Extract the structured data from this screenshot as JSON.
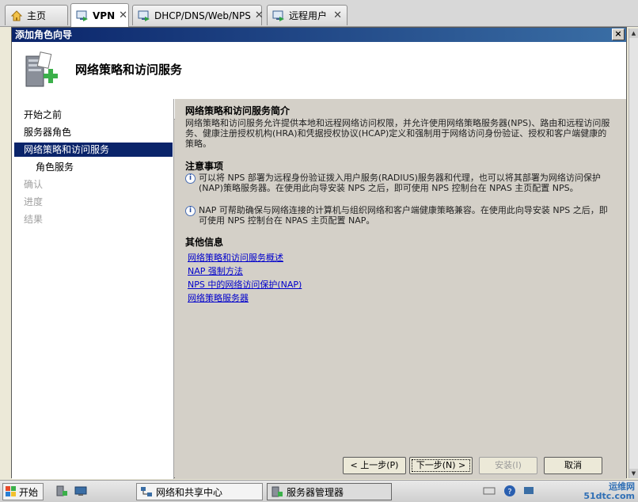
{
  "tabs": [
    {
      "label": "主页",
      "icon": "home-icon"
    },
    {
      "label": "VPN",
      "icon": "vpn-icon",
      "active": true
    },
    {
      "label": "DHCP/DNS/Web/NPS",
      "icon": "monitor-icon"
    },
    {
      "label": "远程用户",
      "icon": "monitor-icon"
    }
  ],
  "wizard": {
    "title": "添加角色向导",
    "close": "×",
    "header_title": "网络策略和访问服务",
    "nav": [
      {
        "label": "开始之前"
      },
      {
        "label": "服务器角色"
      },
      {
        "label": "网络策略和访问服务",
        "selected": true
      },
      {
        "label": "角色服务"
      },
      {
        "label": "确认"
      },
      {
        "label": "进度"
      },
      {
        "label": "结果"
      }
    ],
    "intro_title": "网络策略和访问服务简介",
    "intro_text": "网络策略和访问服务允许提供本地和远程网络访问权限，并允许使用网络策略服务器(NPS)、路由和远程访问服务、健康注册授权机构(HRA)和凭据授权协议(HCAP)定义和强制用于网络访问身份验证、授权和客户端健康的策略。",
    "notes_title": "注意事项",
    "notes": [
      "可以将 NPS 部署为远程身份验证拨入用户服务(RADIUS)服务器和代理，也可以将其部署为网络访问保护(NAP)策略服务器。在使用此向导安装 NPS 之后，即可使用 NPS 控制台在 NPAS 主页配置 NPS。",
      "NAP 可帮助确保与网络连接的计算机与组织网络和客户端健康策略兼容。在使用此向导安装 NPS 之后，即可使用 NPS 控制台在 NPAS 主页配置 NAP。"
    ],
    "info_title": "其他信息",
    "links": [
      "网络策略和访问服务概述",
      "NAP 强制方法",
      "NPS 中的网络访问保护(NAP)",
      "网络策略服务器"
    ],
    "buttons": {
      "back": "< 上一步(P)",
      "next": "下一步(N) >",
      "install": "安装(I)",
      "cancel": "取消"
    }
  },
  "taskbar": {
    "start": "开始",
    "items": [
      {
        "label": "网络和共享中心"
      },
      {
        "label": "服务器管理器"
      }
    ],
    "watermark_line1": "运维网",
    "watermark_line2": "51dtc.com"
  }
}
